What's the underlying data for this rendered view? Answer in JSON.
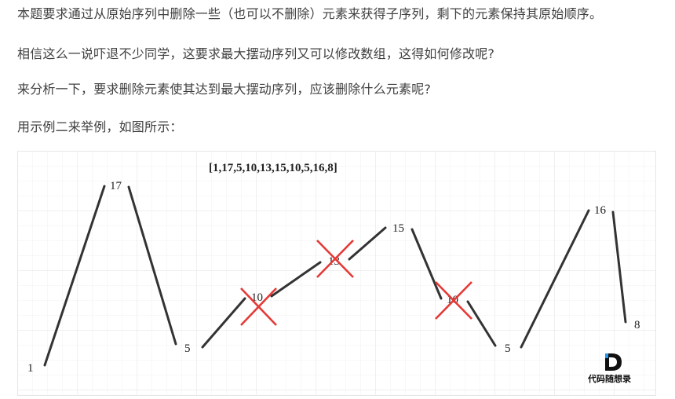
{
  "article": {
    "paragraphs": [
      "本题要求通过从原始序列中删除一些（也可以不删除）元素来获得子序列，剩下的元素保持其原始顺序。",
      "相信这么一说吓退不少同学，这要求最大摆动序列又可以修改数组，这得如何修改呢?",
      "来分析一下，要求删除元素使其达到最大摆动序列，应该删除什么元素呢?",
      "用示例二来举例，如图所示："
    ]
  },
  "figure": {
    "title": "[1,17,5,10,13,15,10,5,16,8]",
    "sequence": [
      1,
      17,
      5,
      10,
      13,
      15,
      10,
      5,
      16,
      8
    ],
    "point_labels": [
      "1",
      "17",
      "5",
      "10",
      "13",
      "15",
      "10",
      "5",
      "16",
      "8"
    ],
    "deleted_indices": [
      3,
      4,
      6
    ],
    "cross_color": "#e53935",
    "line_color": "#333333",
    "watermark": "代码随想录"
  }
}
